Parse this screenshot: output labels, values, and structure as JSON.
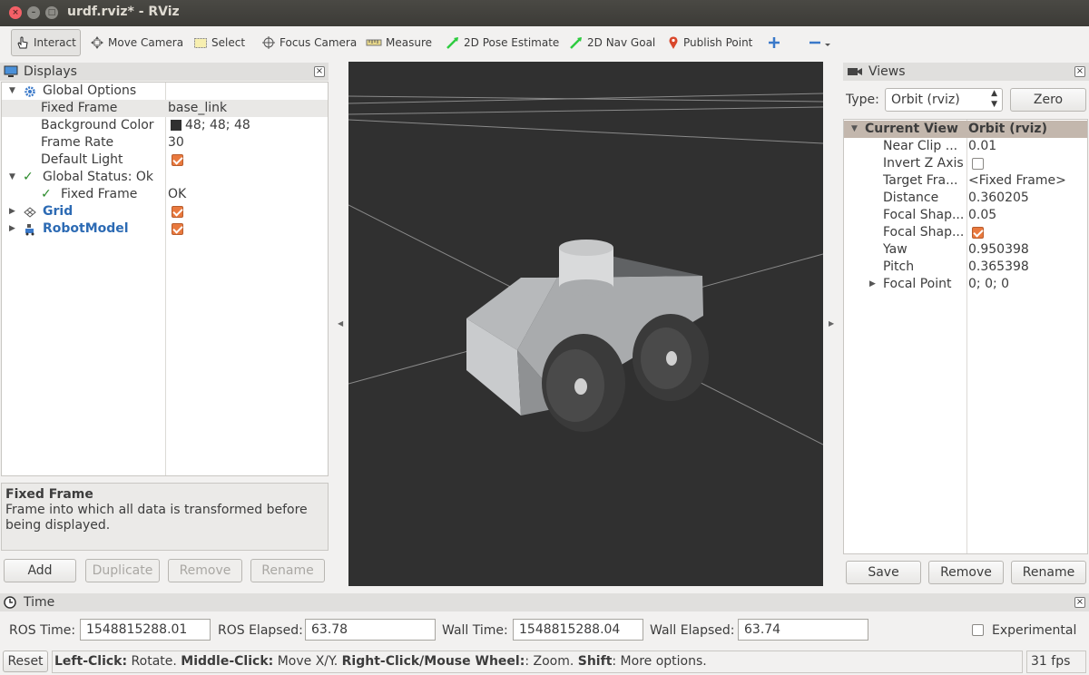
{
  "window": {
    "title": "urdf.rviz* - RViz"
  },
  "toolbar": {
    "interact": "Interact",
    "move_camera": "Move Camera",
    "select": "Select",
    "focus_camera": "Focus Camera",
    "measure": "Measure",
    "pose_estimate": "2D Pose Estimate",
    "nav_goal": "2D Nav Goal",
    "publish_point": "Publish Point"
  },
  "displays": {
    "title": "Displays",
    "global_options": "Global Options",
    "fixed_frame_label": "Fixed Frame",
    "fixed_frame_value": "base_link",
    "bg_color_label": "Background Color",
    "bg_color_value": "48; 48; 48",
    "frame_rate_label": "Frame Rate",
    "frame_rate_value": "30",
    "default_light_label": "Default Light",
    "global_status": "Global Status: Ok",
    "status_fixed_frame_label": "Fixed Frame",
    "status_fixed_frame_value": "OK",
    "grid": "Grid",
    "robot_model": "RobotModel",
    "desc_title": "Fixed Frame",
    "desc_text": "Frame into which all data is transformed before being displayed.",
    "add": "Add",
    "duplicate": "Duplicate",
    "remove": "Remove",
    "rename": "Rename"
  },
  "views": {
    "title": "Views",
    "type_label": "Type:",
    "type_value": "Orbit (rviz)",
    "zero": "Zero",
    "current_view": "Current View",
    "current_view_value": "Orbit (rviz)",
    "near_clip_label": "Near Clip ...",
    "near_clip_value": "0.01",
    "invert_z_label": "Invert Z Axis",
    "target_frame_label": "Target Fra...",
    "target_frame_value": "<Fixed Frame>",
    "distance_label": "Distance",
    "distance_value": "0.360205",
    "focal_shape1_label": "Focal Shap...",
    "focal_shape1_value": "0.05",
    "focal_shape2_label": "Focal Shap...",
    "yaw_label": "Yaw",
    "yaw_value": "0.950398",
    "pitch_label": "Pitch",
    "pitch_value": "0.365398",
    "focal_point_label": "Focal Point",
    "focal_point_value": "0; 0; 0",
    "save": "Save",
    "remove": "Remove",
    "rename": "Rename"
  },
  "time": {
    "title": "Time",
    "ros_time_label": "ROS Time:",
    "ros_time_value": "1548815288.01",
    "ros_elapsed_label": "ROS Elapsed:",
    "ros_elapsed_value": "63.78",
    "wall_time_label": "Wall Time:",
    "wall_time_value": "1548815288.04",
    "wall_elapsed_label": "Wall Elapsed:",
    "wall_elapsed_value": "63.74",
    "experimental": "Experimental"
  },
  "statusbar": {
    "reset": "Reset",
    "b1": "Left-Click:",
    "t1": " Rotate. ",
    "b2": "Middle-Click:",
    "t2": " Move X/Y. ",
    "b3": "Right-Click/Mouse Wheel:",
    "t3": ": Zoom. ",
    "b4": "Shift",
    "t4": ": More options.",
    "fps": "31 fps"
  },
  "colors": {
    "viewport_bg": "#303030",
    "check_orange": "#e9793e",
    "selected_header": "#c3b7ad",
    "link_blue": "#2d6bb4"
  }
}
